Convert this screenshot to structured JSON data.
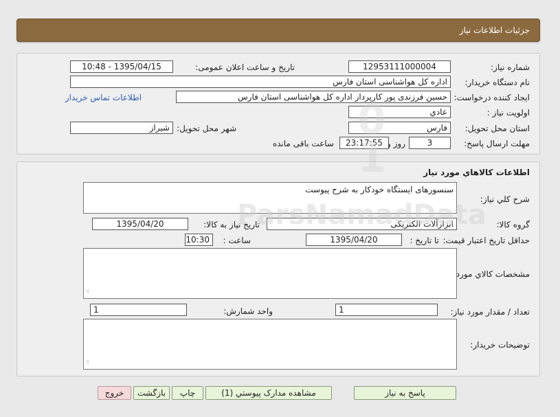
{
  "header": {
    "title": "جزئیات اطلاعات نیاز"
  },
  "need_info": {
    "need_number_label": "شماره نیاز:",
    "need_number": "12953111000004",
    "announce_label": "تاریخ و ساعت اعلان عمومی:",
    "announce_value": "1395/04/15 - 10:48",
    "buyer_org_label": "نام دستگاه خریدار:",
    "buyer_org": "اداره کل هواشناسی استان فارس",
    "requester_label": "ایجاد کننده درخواست:",
    "requester": "حسین  فرزندی پور کارپرداز اداره کل هواشناسی استان فارس",
    "contact_link": "اطلاعات تماس خریدار",
    "priority_label": "اولویت نیاز :",
    "priority": "عادي",
    "province_label": "استان محل تحویل:",
    "province": "فارس",
    "city_label": "شهر محل تحویل:",
    "city": "شیراز",
    "deadline_label": "مهلت ارسال پاسخ:",
    "deadline_days": "3",
    "days_label": "روز و",
    "deadline_time": "23:17:55",
    "remaining_label": "ساعت باقی مانده"
  },
  "goods": {
    "section_title": "اطلاعات کالاهاي مورد نياز",
    "general_desc_label": "شرح کلي نياز:",
    "general_desc": "سنسورهای ایستگاه خودکار به شرح پیوست",
    "goods_group_label": "گروه کالا:",
    "goods_group": "ابزارآلات الکتریکی",
    "need_date_label": "تاریخ نیاز به کالا:",
    "need_date": "1395/04/20",
    "price_validity_label": "حداقل تاریخ اعتبار قیمت:",
    "until_date_label": "تا تاریخ :",
    "until_date": "1395/04/20",
    "hour_label": "ساعت :",
    "hour": "10:30",
    "specs_label": "مشخصات کالاي مورد نياز:",
    "specs": "",
    "qty_label": "تعداد / مقدار مورد نیاز:",
    "qty": "1",
    "unit_label": "واحد شمارش:",
    "unit": "1",
    "buyer_notes_label": "توضیحات خریدار:",
    "buyer_notes": ""
  },
  "buttons": {
    "reply": "پاسخ به نیاز",
    "attachments": "مشاهده مدارک پیوستي (1)",
    "print": "چاپ",
    "back": "بازگشت",
    "exit": "خروج"
  },
  "colors": {
    "header_bg": "#8a6a3e",
    "button_bg": "#e9f5d9",
    "exit_button_bg": "#f6d9d9",
    "link": "#2a5db0"
  }
}
